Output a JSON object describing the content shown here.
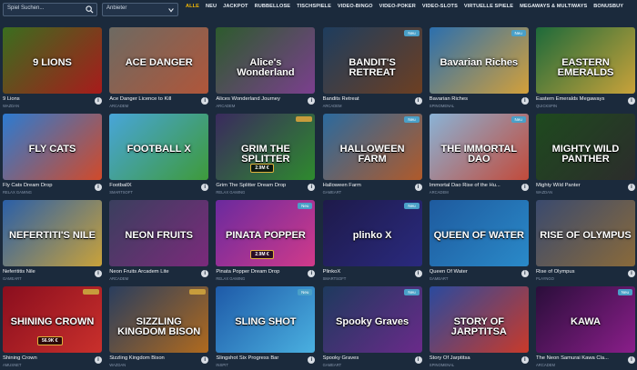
{
  "search": {
    "placeholder": "Spiel Suchen..."
  },
  "provider": {
    "placeholder": "Anbieter"
  },
  "tabs": [
    "ALLE",
    "NEU",
    "JACKPOT",
    "RUBBELLOSE",
    "TISCHSPIELE",
    "VIDEO-BINGO",
    "VIDEO-POKER",
    "VIDEO-SLOTS",
    "VIRTUELLE SPIELE",
    "MEGAWAYS & MULTIWAYS",
    "BONUSBUY"
  ],
  "active_tab": "ALLE",
  "games": [
    {
      "title": "9 Lions",
      "provider": "WAZDAN",
      "art": "9 LIONS",
      "c1": "#3a6e1f",
      "c2": "#a81b1b",
      "badge": ""
    },
    {
      "title": "Ace Danger Licence to Kill",
      "provider": "ARCADEM",
      "art": "ACE DANGER",
      "c1": "#6d6a62",
      "c2": "#b0563a",
      "badge": ""
    },
    {
      "title": "Alices Wonderland Journey",
      "provider": "ARCADEM",
      "art": "Alice's Wonderland",
      "c1": "#2d5b2d",
      "c2": "#7b3f8e",
      "badge": ""
    },
    {
      "title": "Bandits Retreat",
      "provider": "ARCADEM",
      "art": "BANDIT'S RETREAT",
      "c1": "#1e3d5e",
      "c2": "#6d3f22",
      "badge": "Neu"
    },
    {
      "title": "Bavarian Riches",
      "provider": "SPINOMENAL",
      "art": "Bavarian Riches",
      "c1": "#2b6fae",
      "c2": "#d3a03a",
      "badge": "Neu"
    },
    {
      "title": "Eastern Emeralds Megaways",
      "provider": "QUICKSPIN",
      "art": "EASTERN EMERALDS",
      "c1": "#1d6a3a",
      "c2": "#c9a23a",
      "badge": ""
    },
    {
      "title": "Fly Cats Dream Drop",
      "provider": "RELAX GAMING",
      "art": "FLY CATS",
      "c1": "#2c7bd1",
      "c2": "#d14a2a",
      "badge": ""
    },
    {
      "title": "FootballX",
      "provider": "SMARTSOFT",
      "art": "FOOTBALL X",
      "c1": "#48a5d9",
      "c2": "#3e9a3a",
      "badge": ""
    },
    {
      "title": "Grim The Splitter Dream Drop",
      "provider": "RELAX GAMING",
      "art": "GRIM THE SPLITTER",
      "c1": "#3a2a5e",
      "c2": "#2e8a2e",
      "badge": "gold",
      "jackpot": "2.9M €"
    },
    {
      "title": "Halloween Farm",
      "provider": "GAMEART",
      "art": "HALLOWEEN FARM",
      "c1": "#2b6a9e",
      "c2": "#b05a2a",
      "badge": "Neu"
    },
    {
      "title": "Immortal Dao Rise of the Hu...",
      "provider": "ARCADEM",
      "art": "THE IMMORTAL DAO",
      "c1": "#8ab3d6",
      "c2": "#c24a3a",
      "badge": "Neu"
    },
    {
      "title": "Mighty Wild Panter",
      "provider": "WAZDAN",
      "art": "MIGHTY WILD PANTHER",
      "c1": "#1e4a1e",
      "c2": "#2c2c2c",
      "badge": ""
    },
    {
      "title": "Neferititis Nile",
      "provider": "GAMEART",
      "art": "NEFERTITI'S NILE",
      "c1": "#2a5fa8",
      "c2": "#c9a23a",
      "badge": ""
    },
    {
      "title": "Neon Fruits Arcadem Lite",
      "provider": "ARCADEM",
      "art": "NEON FRUITS",
      "c1": "#3a3f5e",
      "c2": "#7b2a7b",
      "badge": ""
    },
    {
      "title": "Pinata Popper Dream Drop",
      "provider": "RELAX GAMING",
      "art": "PINATA POPPER",
      "c1": "#6a2a9e",
      "c2": "#d13a8a",
      "badge": "Neu",
      "jackpot": "2.9M €"
    },
    {
      "title": "PlinkoX",
      "provider": "SMARTSOFT",
      "art": "plinko X",
      "c1": "#1e1a4a",
      "c2": "#2a2a7e",
      "badge": "Neu"
    },
    {
      "title": "Queen Of Water",
      "provider": "GAMEART",
      "art": "QUEEN OF WATER",
      "c1": "#1e5a9e",
      "c2": "#2a8ac9",
      "badge": ""
    },
    {
      "title": "Rise of Olympus",
      "provider": "PLAYNGO",
      "art": "RISE OF OLYMPUS",
      "c1": "#3a4a6e",
      "c2": "#8a6a3a",
      "badge": ""
    },
    {
      "title": "Shining Crown",
      "provider": "AMUSNET",
      "art": "SHINING CROWN",
      "c1": "#8a0e1e",
      "c2": "#c9302c",
      "badge": "gold",
      "jackpot": "56.9K €"
    },
    {
      "title": "Sizzling Kingdom Bison",
      "provider": "WAZDAN",
      "art": "SIZZLING KINGDOM BISON",
      "c1": "#2a3e5e",
      "c2": "#b06a1e",
      "badge": "gold"
    },
    {
      "title": "Slingshot Six Progress Bar",
      "provider": "INSPIT",
      "art": "SLING SHOT",
      "c1": "#1e5aa8",
      "c2": "#4ab0e0",
      "badge": "Neu"
    },
    {
      "title": "Spooky Graves",
      "provider": "GAMEART",
      "art": "Spooky Graves",
      "c1": "#1e3a5e",
      "c2": "#6a2a8a",
      "badge": "Neu"
    },
    {
      "title": "Story Of Jarptitsa",
      "provider": "SPINOMENAL",
      "art": "STORY OF JARPTITSA",
      "c1": "#2a4a9e",
      "c2": "#c93a2a",
      "badge": ""
    },
    {
      "title": "The Neon Samurai Kawa Cla...",
      "provider": "ARCADEM",
      "art": "KAWA",
      "c1": "#2a0e3a",
      "c2": "#8a1e8a",
      "badge": "Neu"
    }
  ],
  "info_glyph": "i",
  "colors": {
    "background": "#1b2a3c",
    "active_tab": "#f2b705",
    "badge_new": "#4aa0c8",
    "badge_jackpot": "#c79c3c"
  }
}
